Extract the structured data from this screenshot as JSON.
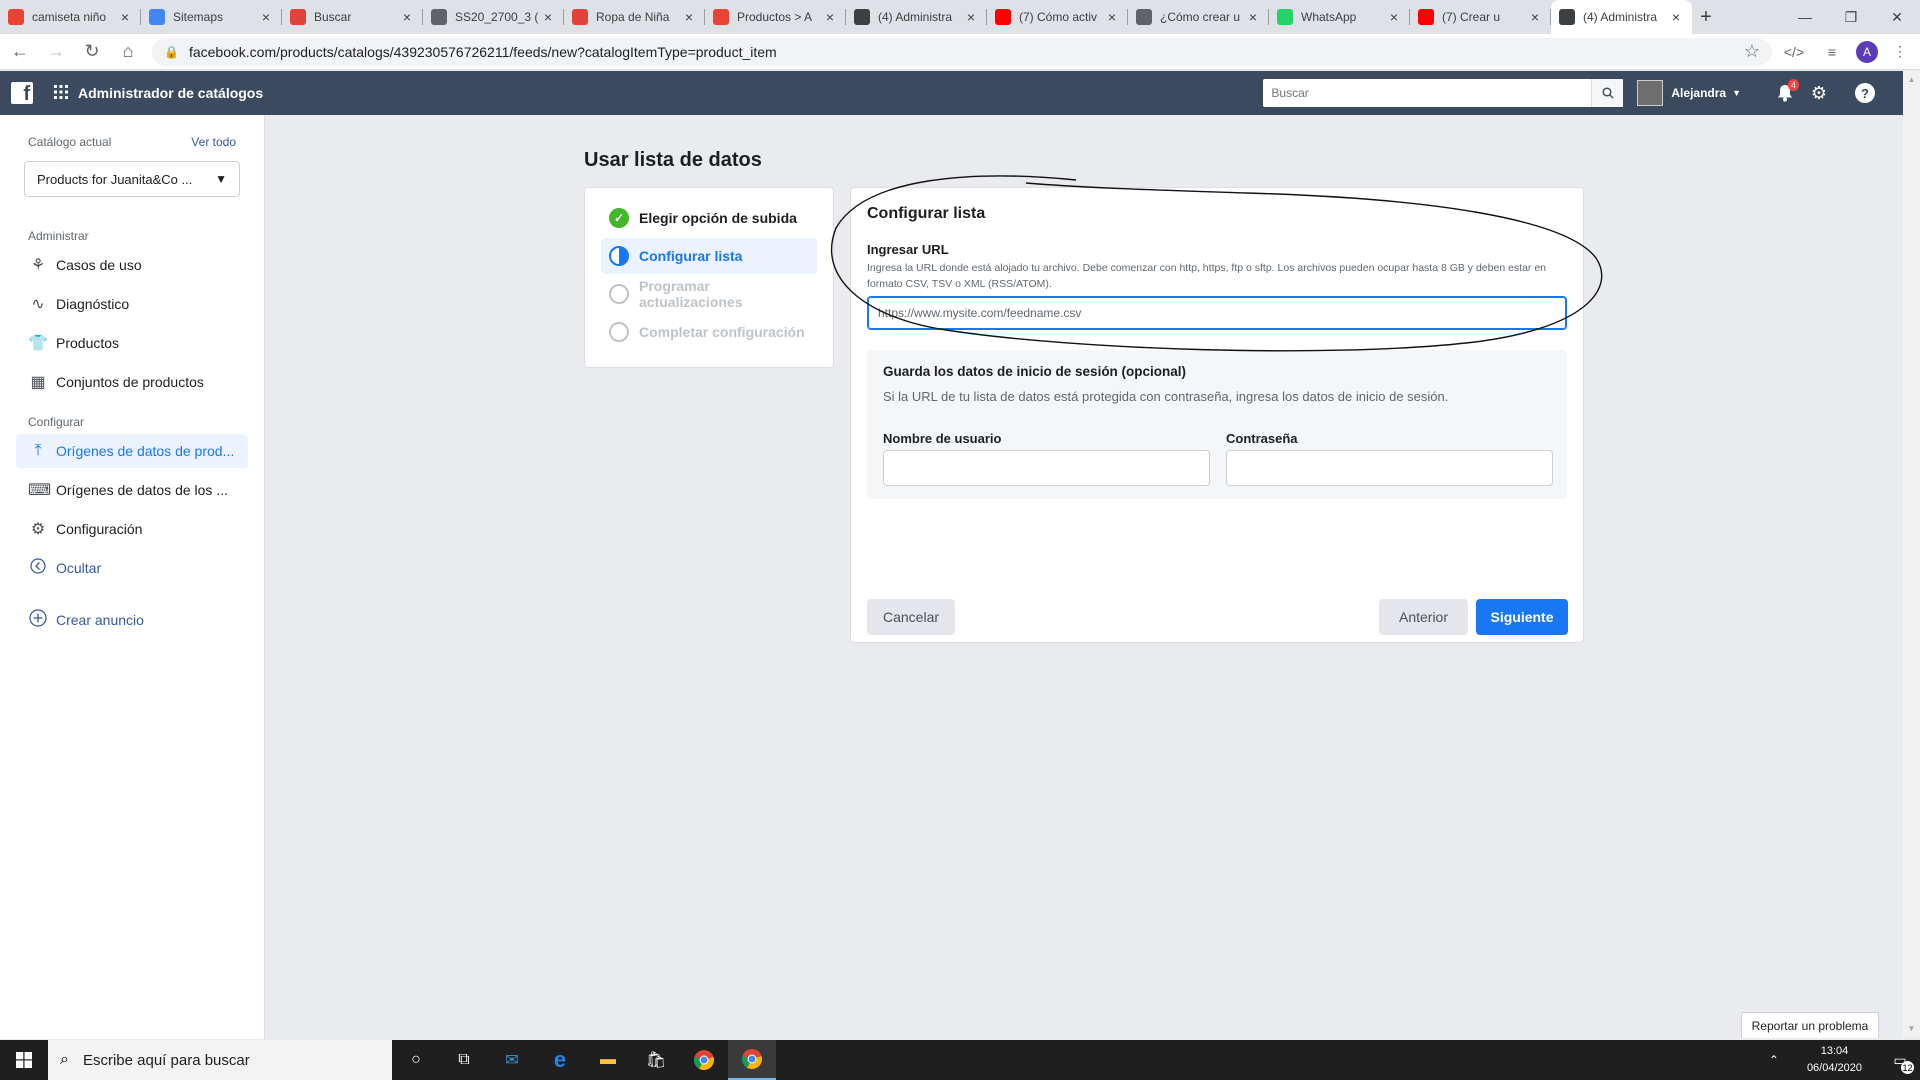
{
  "browser": {
    "tabs": [
      {
        "title": "camiseta niño",
        "favicon_color": "#ea4335",
        "favicon": "shop-icon"
      },
      {
        "title": "Sitemaps",
        "favicon_color": "#4285f4",
        "favicon": "sitemap-icon"
      },
      {
        "title": "Buscar",
        "favicon_color": "#e0433a",
        "favicon": "circle-icon"
      },
      {
        "title": "SS20_2700_3 (",
        "favicon_color": "#5f6368",
        "favicon": "globe-icon"
      },
      {
        "title": "Ropa de Niña",
        "favicon_color": "#e0433a",
        "favicon": "circle-icon"
      },
      {
        "title": "Productos > A",
        "favicon_color": "#ea4335",
        "favicon": "shop-icon"
      },
      {
        "title": "(4) Administra",
        "favicon_color": "#3c4043",
        "favicon": "catalog-icon"
      },
      {
        "title": "(7) Cómo activ",
        "favicon_color": "#ff0000",
        "favicon": "youtube-icon"
      },
      {
        "title": "¿Cómo crear u",
        "favicon_color": "#5f6368",
        "favicon": "hat-icon"
      },
      {
        "title": "WhatsApp",
        "favicon_color": "#25d366",
        "favicon": "whatsapp-icon"
      },
      {
        "title": "(7) Crear u",
        "favicon_color": "#ff0000",
        "favicon": "youtube-icon"
      },
      {
        "title": "(4) Administra",
        "favicon_color": "#3c4043",
        "favicon": "catalog-icon",
        "active": true
      }
    ],
    "url": "facebook.com/products/catalogs/439230576726211/feeds/new?catalogItemType=product_item",
    "profile_initial": "A"
  },
  "topbar": {
    "title": "Administrador de catálogos",
    "search_placeholder": "Buscar",
    "user_name": "Alejandra",
    "notifications_count": "4"
  },
  "sidebar": {
    "current_catalog_label": "Catálogo actual",
    "see_all": "Ver todo",
    "catalog_name": "Products for Juanita&Co ...",
    "section_manage": "Administrar",
    "manage_items": [
      {
        "label": "Casos de uso",
        "icon": "use-cases-icon"
      },
      {
        "label": "Diagnóstico",
        "icon": "pulse-icon"
      },
      {
        "label": "Productos",
        "icon": "shirt-icon"
      },
      {
        "label": "Conjuntos de productos",
        "icon": "grid-icon"
      }
    ],
    "section_configure": "Configurar",
    "configure_items": [
      {
        "label": "Orígenes de datos de prod...",
        "icon": "upload-icon",
        "active": true
      },
      {
        "label": "Orígenes de datos de los ...",
        "icon": "code-window-icon"
      },
      {
        "label": "Configuración",
        "icon": "gear-icon"
      }
    ],
    "hide": "Ocultar",
    "create_ad": "Crear anuncio"
  },
  "main": {
    "title": "Usar lista de datos",
    "steps": [
      {
        "label": "Elegir opción de subida",
        "state": "done"
      },
      {
        "label": "Configurar lista",
        "state": "current"
      },
      {
        "label": "Programar actualizaciones",
        "state": "pending"
      },
      {
        "label": "Completar configuración",
        "state": "pending"
      }
    ],
    "panel": {
      "title": "Configurar lista",
      "url_label": "Ingresar URL",
      "url_help": "Ingresa la URL donde está alojado tu archivo. Debe comenzar con http, https, ftp o sftp. Los archivos pueden ocupar hasta 8 GB y deben estar en formato CSV, TSV o XML (RSS/ATOM).",
      "url_placeholder": "https://www.mysite.com/feedname.csv",
      "login_title": "Guarda los datos de inicio de sesión (opcional)",
      "login_desc": "Si la URL de tu lista de datos está protegida con contraseña, ingresa los datos de inicio de sesión.",
      "username_label": "Nombre de usuario",
      "password_label": "Contraseña",
      "cancel": "Cancelar",
      "previous": "Anterior",
      "next": "Siguiente"
    },
    "report_problem": "Reportar un problema"
  },
  "taskbar": {
    "search_placeholder": "Escribe aquí para buscar",
    "time": "13:04",
    "date": "06/04/2020",
    "notif_count": "12"
  },
  "colors": {
    "fb_bar": "#3b4a5f",
    "accent": "#1877f2",
    "done": "#42b72a"
  }
}
